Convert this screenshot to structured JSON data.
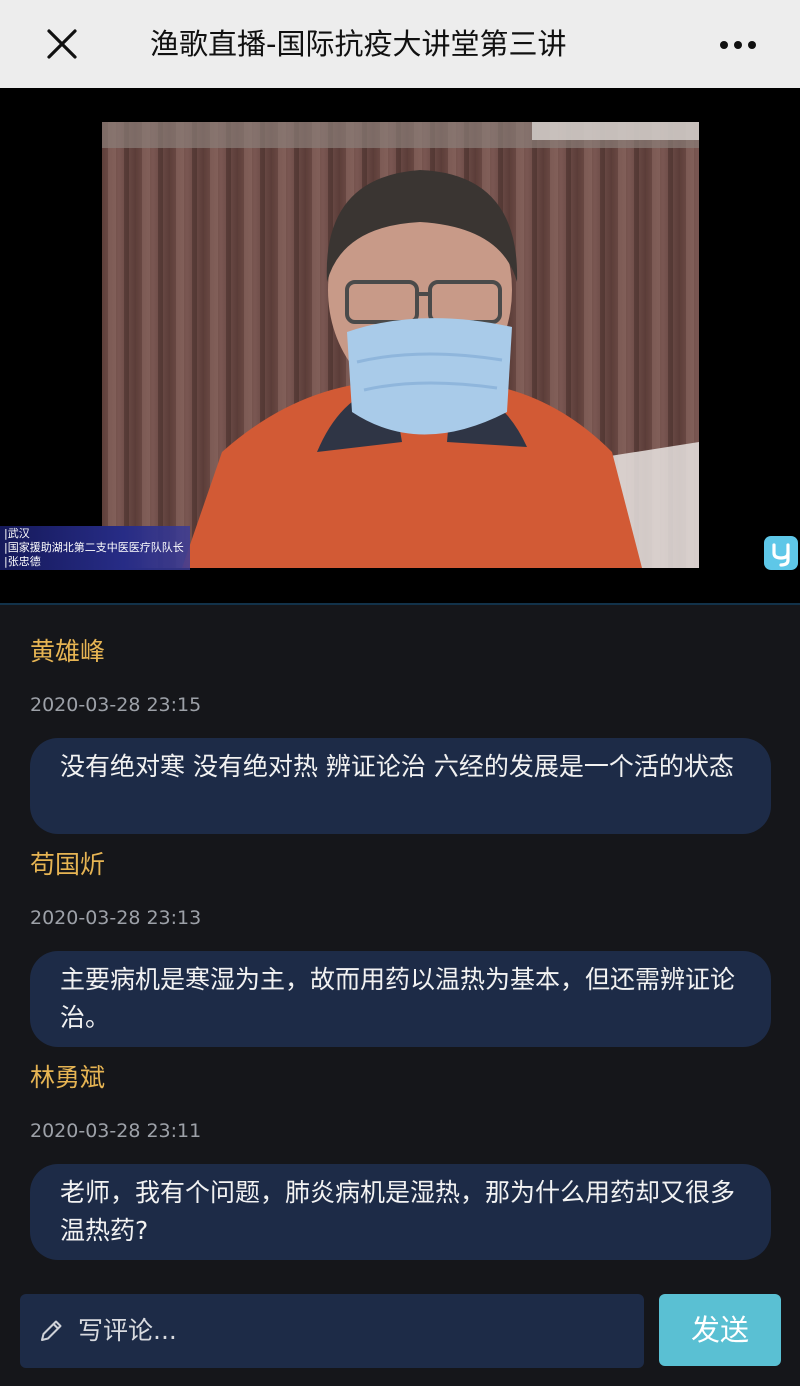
{
  "header": {
    "title": "渔歌直播-国际抗疫大讲堂第三讲"
  },
  "video": {
    "caption_lines": [
      "|武汉",
      "|国家援助湖北第二支中医医疗队队长",
      "|张忠德"
    ],
    "logo_letter": "y"
  },
  "comments": [
    {
      "name": "黄雄峰",
      "time": "2020-03-28 23:15",
      "text": "没有绝对寒 没有绝对热 辨证论治 六经的发展是一个活的状态"
    },
    {
      "name": "苟国炘",
      "time": "2020-03-28 23:13",
      "text": "主要病机是寒湿为主，故而用药以温热为基本，但还需辨证论治。"
    },
    {
      "name": "林勇斌",
      "time": "2020-03-28 23:11",
      "text": "老师，我有个问题，肺炎病机是湿热，那为什么用药却又很多温热药?"
    }
  ],
  "footer": {
    "placeholder": "写评论...",
    "send_label": "发送"
  },
  "icons": {
    "close": "close-icon",
    "more": "more-icon",
    "pencil": "pencil-icon"
  },
  "colors": {
    "username": "#e6b453",
    "bubble": "#1d2b47",
    "send_button": "#5ac0d3",
    "background": "#15161a"
  }
}
